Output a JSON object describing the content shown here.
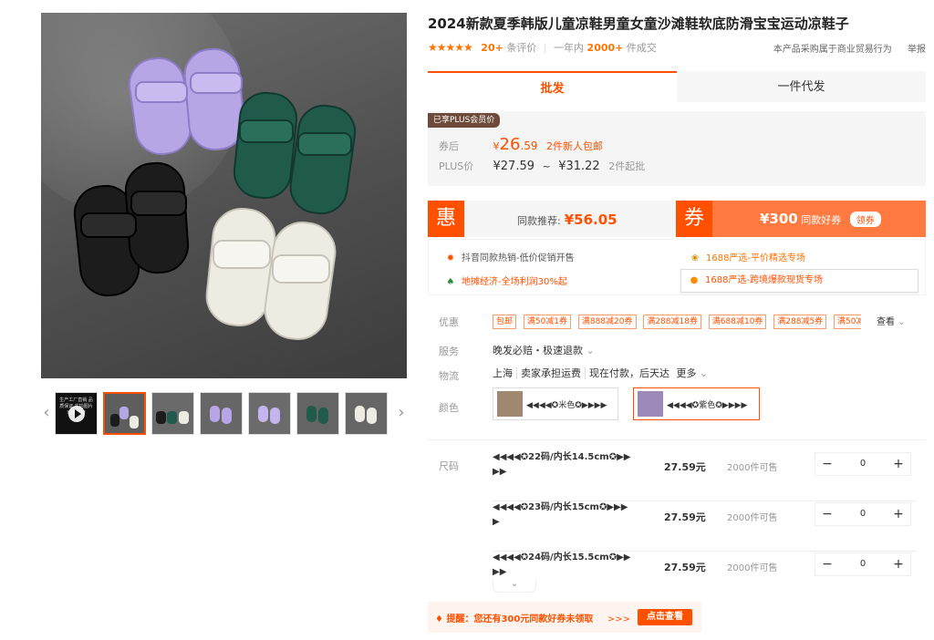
{
  "product": {
    "title": "2024新款夏季韩版儿童凉鞋男童女童沙滩鞋软底防滑宝宝运动凉鞋子",
    "rating_stars": "★★★★★",
    "review_count": "20+",
    "review_label": "条评价",
    "year_label": "一年内",
    "sales_count": "2000+",
    "sales_label": "件成交",
    "commercial_note": "本产品采购属于商业贸易行为",
    "report_label": "举报"
  },
  "gallery": {
    "video_caption": "生产工厂直销 品质保证 实拍图片 欢迎咨询",
    "prev_arrow": "‹",
    "next_arrow": "›"
  },
  "tabs": {
    "wholesale": "批发",
    "dropship": "一件代发"
  },
  "plus": {
    "badge": "已享PLUS会员价",
    "after_coupon_label": "券后",
    "after_coupon_yen": "¥",
    "after_coupon_int": "26",
    "after_coupon_dec": ".59",
    "after_coupon_note": "2件新人包邮",
    "plus_label": "PLUS价",
    "range_low": "¥27.59",
    "range_sep": "~",
    "range_high": "¥31.22",
    "range_note": "2件起批"
  },
  "promo": {
    "hui_badge": "惠",
    "same_item_text": "同款推荐:",
    "same_item_price": "¥56.05",
    "coupon_badge": "券",
    "coupon_amount": "¥300",
    "coupon_text": "同款好券",
    "coupon_btn": "领券"
  },
  "hot_links": {
    "a": "抖音同款热销-低价促销开售",
    "b": "地摊经济-全场利润30%起",
    "c": "1688严选-平价精选专场",
    "d": "1688严选-跨境爆款现货专场"
  },
  "labels": {
    "discount": "优惠",
    "service": "服务",
    "logistics": "物流",
    "color": "颜色",
    "size": "尺码",
    "look": "查看"
  },
  "discount_tags": [
    "包邮",
    "满50减1券",
    "满888减20券",
    "满288减18券",
    "满688减10券",
    "满288减5券",
    "满50减"
  ],
  "service": {
    "text": "晚发必赔・极速退款"
  },
  "logistics": {
    "origin": "上海",
    "freight": "卖家承担运费",
    "delivery": "现在付款，后天达",
    "more": "更多"
  },
  "colors": [
    {
      "name": "◀◀◀◀✪米色✪▶▶▶▶"
    },
    {
      "name": "◀◀◀◀✪紫色✪▶▶▶▶"
    }
  ],
  "skus": [
    {
      "name": "◀◀◀◀✪22码/内长14.5cm✪▶▶▶▶",
      "price": "27.59元",
      "stock": "2000件可售",
      "qty": "0"
    },
    {
      "name": "◀◀◀◀✪23码/内长15cm✪▶▶▶▶",
      "price": "27.59元",
      "stock": "2000件可售",
      "qty": "0"
    },
    {
      "name": "◀◀◀◀✪24码/内长15.5cm✪▶▶▶▶",
      "price": "27.59元",
      "stock": "2000件可售",
      "qty": "0"
    }
  ],
  "reminder": {
    "text": "提醒：您还有300元同款好券未领取",
    "arrows": ">>>",
    "button": "点击查看"
  },
  "colors_theme": {
    "accent": "#ff5000",
    "orange": "#ff7300"
  }
}
